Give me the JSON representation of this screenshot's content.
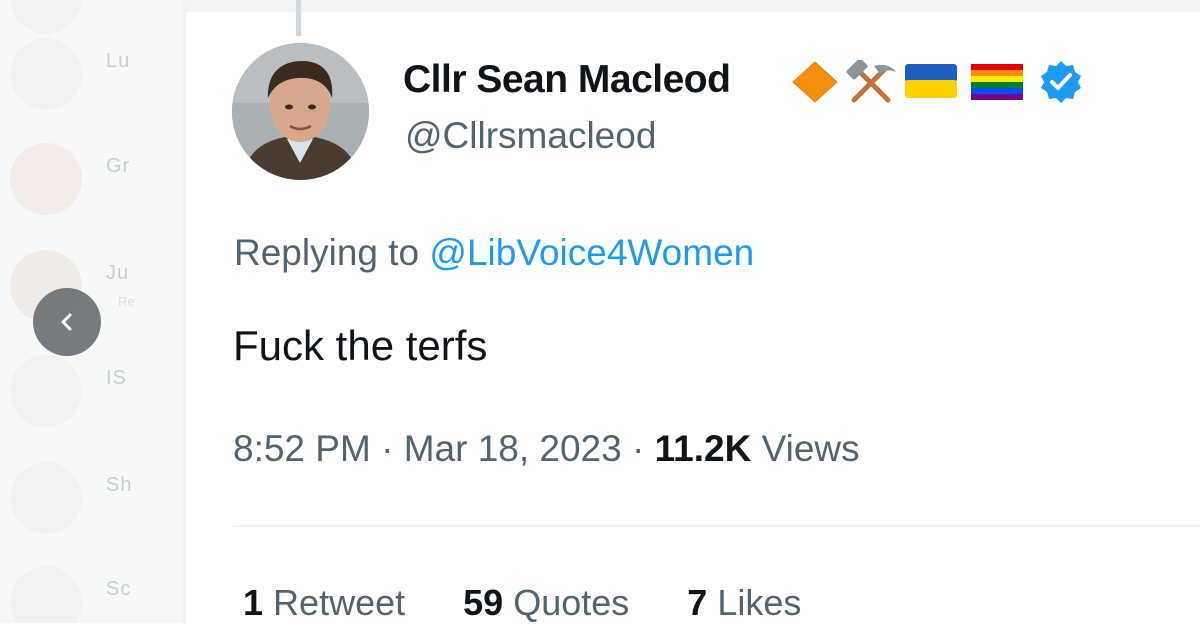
{
  "sidebar": {
    "items": [
      {
        "name": "Lu",
        "sub": ""
      },
      {
        "name": "Gr",
        "sub": ""
      },
      {
        "name": "Ju",
        "sub": "Re"
      },
      {
        "name": "IS",
        "sub": ""
      },
      {
        "name": "Sh",
        "sub": ""
      },
      {
        "name": "Sc",
        "sub": ""
      }
    ]
  },
  "tweet": {
    "display_name": "Cllr Sean Macleod",
    "handle": "@Cllrsmacleod",
    "badges": [
      "orange-diamond-icon",
      "hammer-and-pick-icon",
      "ukraine-flag-icon",
      "rainbow-flag-icon",
      "verified-badge-icon"
    ],
    "replying_prefix": "Replying to",
    "replying_to": "@LibVoice4Women",
    "text": "Fuck the terfs",
    "time": "8:52 PM",
    "separator": "·",
    "date": "Mar 18, 2023",
    "views_count": "11.2K",
    "views_label": "Views"
  },
  "stats": {
    "retweets_count": "1",
    "retweets_label": "Retweet",
    "quotes_count": "59",
    "quotes_label": "Quotes",
    "likes_count": "7",
    "likes_label": "Likes"
  },
  "colors": {
    "accent": "#1d9bf0",
    "secondary_text": "#536471",
    "primary_text": "#0f1419",
    "verified": "#1d9bf0"
  }
}
